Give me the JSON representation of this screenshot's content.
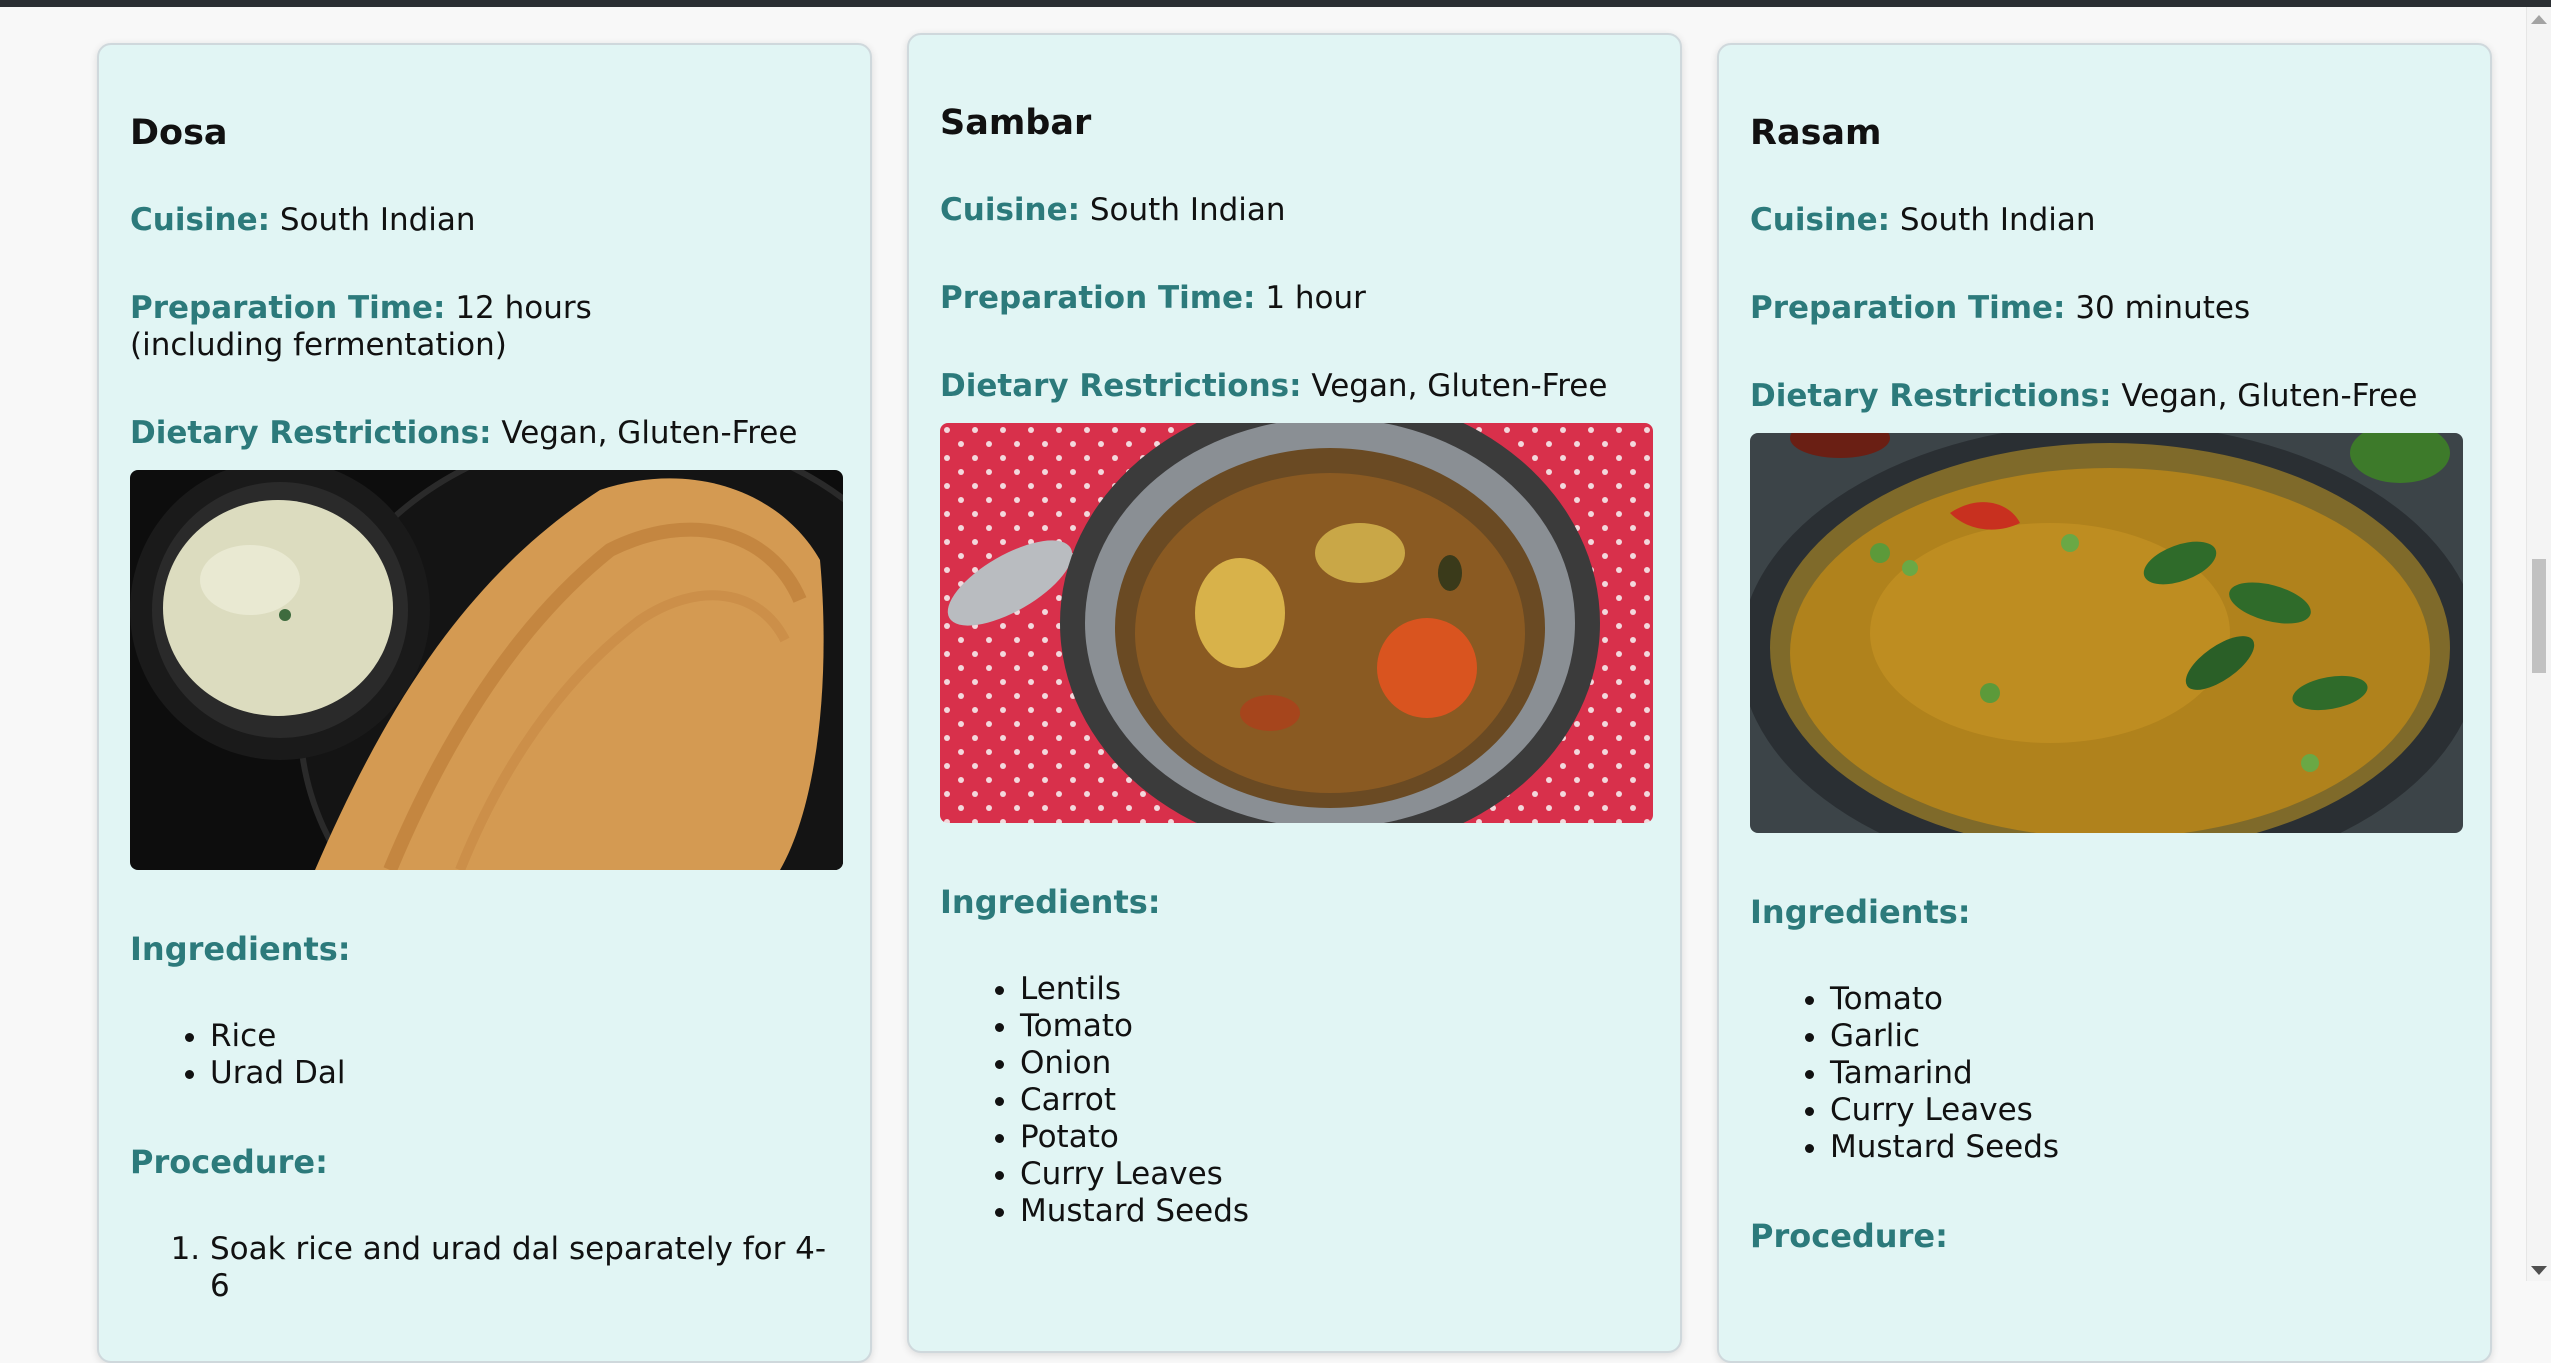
{
  "recipes": [
    {
      "name": "Dosa",
      "cuisine_label": "Cuisine:",
      "cuisine": "South Indian",
      "prep_label": "Preparation Time:",
      "prep_time": "12 hours (including fermentation)",
      "diet_label": "Dietary Restrictions:",
      "diet": "Vegan, Gluten-Free",
      "image_subject": "dosa with coconut chutney",
      "ingredients_label": "Ingredients:",
      "ingredients": [
        "Rice",
        "Urad Dal"
      ],
      "procedure_label": "Procedure:",
      "procedure": [
        "Soak rice and urad dal separately for 4-6"
      ]
    },
    {
      "name": "Sambar",
      "cuisine_label": "Cuisine:",
      "cuisine": "South Indian",
      "prep_label": "Preparation Time:",
      "prep_time": "1 hour",
      "diet_label": "Dietary Restrictions:",
      "diet": "Vegan, Gluten-Free",
      "image_subject": "bowl of sambar",
      "ingredients_label": "Ingredients:",
      "ingredients": [
        "Lentils",
        "Tomato",
        "Onion",
        "Carrot",
        "Potato",
        "Curry Leaves",
        "Mustard Seeds"
      ]
    },
    {
      "name": "Rasam",
      "cuisine_label": "Cuisine:",
      "cuisine": "South Indian",
      "prep_label": "Preparation Time:",
      "prep_time": "30 minutes",
      "diet_label": "Dietary Restrictions:",
      "diet": "Vegan, Gluten-Free",
      "image_subject": "bowl of rasam",
      "ingredients_label": "Ingredients:",
      "ingredients": [
        "Tomato",
        "Garlic",
        "Tamarind",
        "Curry Leaves",
        "Mustard Seeds"
      ],
      "procedure_label": "Procedure:"
    }
  ],
  "colors": {
    "card_bg": "#e1f5f4",
    "label_teal": "#2c7a7b",
    "page_bg": "#f8f8f8"
  }
}
